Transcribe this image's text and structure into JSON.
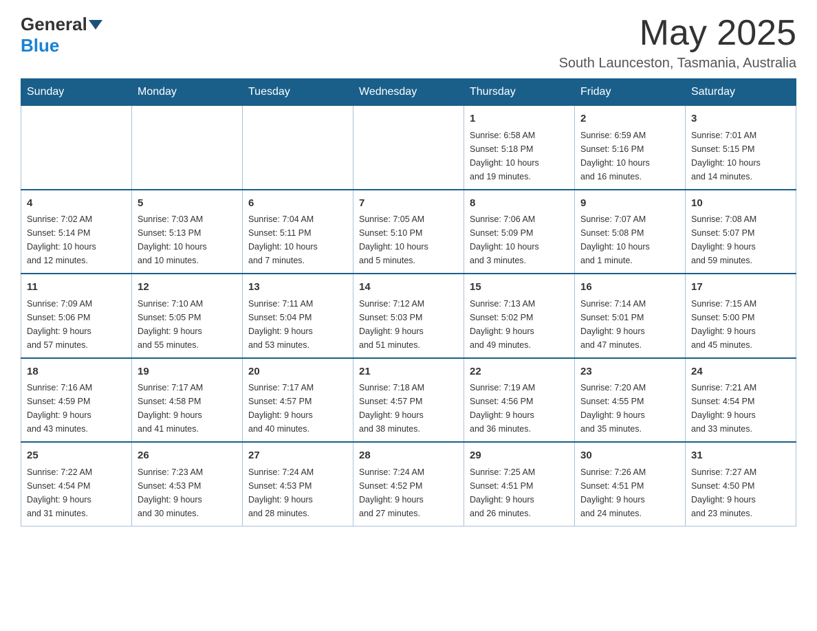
{
  "header": {
    "logo_general": "General",
    "logo_blue": "Blue",
    "month_title": "May 2025",
    "location": "South Launceston, Tasmania, Australia"
  },
  "days_of_week": [
    "Sunday",
    "Monday",
    "Tuesday",
    "Wednesday",
    "Thursday",
    "Friday",
    "Saturday"
  ],
  "weeks": [
    [
      {
        "day": "",
        "info": ""
      },
      {
        "day": "",
        "info": ""
      },
      {
        "day": "",
        "info": ""
      },
      {
        "day": "",
        "info": ""
      },
      {
        "day": "1",
        "info": "Sunrise: 6:58 AM\nSunset: 5:18 PM\nDaylight: 10 hours\nand 19 minutes."
      },
      {
        "day": "2",
        "info": "Sunrise: 6:59 AM\nSunset: 5:16 PM\nDaylight: 10 hours\nand 16 minutes."
      },
      {
        "day": "3",
        "info": "Sunrise: 7:01 AM\nSunset: 5:15 PM\nDaylight: 10 hours\nand 14 minutes."
      }
    ],
    [
      {
        "day": "4",
        "info": "Sunrise: 7:02 AM\nSunset: 5:14 PM\nDaylight: 10 hours\nand 12 minutes."
      },
      {
        "day": "5",
        "info": "Sunrise: 7:03 AM\nSunset: 5:13 PM\nDaylight: 10 hours\nand 10 minutes."
      },
      {
        "day": "6",
        "info": "Sunrise: 7:04 AM\nSunset: 5:11 PM\nDaylight: 10 hours\nand 7 minutes."
      },
      {
        "day": "7",
        "info": "Sunrise: 7:05 AM\nSunset: 5:10 PM\nDaylight: 10 hours\nand 5 minutes."
      },
      {
        "day": "8",
        "info": "Sunrise: 7:06 AM\nSunset: 5:09 PM\nDaylight: 10 hours\nand 3 minutes."
      },
      {
        "day": "9",
        "info": "Sunrise: 7:07 AM\nSunset: 5:08 PM\nDaylight: 10 hours\nand 1 minute."
      },
      {
        "day": "10",
        "info": "Sunrise: 7:08 AM\nSunset: 5:07 PM\nDaylight: 9 hours\nand 59 minutes."
      }
    ],
    [
      {
        "day": "11",
        "info": "Sunrise: 7:09 AM\nSunset: 5:06 PM\nDaylight: 9 hours\nand 57 minutes."
      },
      {
        "day": "12",
        "info": "Sunrise: 7:10 AM\nSunset: 5:05 PM\nDaylight: 9 hours\nand 55 minutes."
      },
      {
        "day": "13",
        "info": "Sunrise: 7:11 AM\nSunset: 5:04 PM\nDaylight: 9 hours\nand 53 minutes."
      },
      {
        "day": "14",
        "info": "Sunrise: 7:12 AM\nSunset: 5:03 PM\nDaylight: 9 hours\nand 51 minutes."
      },
      {
        "day": "15",
        "info": "Sunrise: 7:13 AM\nSunset: 5:02 PM\nDaylight: 9 hours\nand 49 minutes."
      },
      {
        "day": "16",
        "info": "Sunrise: 7:14 AM\nSunset: 5:01 PM\nDaylight: 9 hours\nand 47 minutes."
      },
      {
        "day": "17",
        "info": "Sunrise: 7:15 AM\nSunset: 5:00 PM\nDaylight: 9 hours\nand 45 minutes."
      }
    ],
    [
      {
        "day": "18",
        "info": "Sunrise: 7:16 AM\nSunset: 4:59 PM\nDaylight: 9 hours\nand 43 minutes."
      },
      {
        "day": "19",
        "info": "Sunrise: 7:17 AM\nSunset: 4:58 PM\nDaylight: 9 hours\nand 41 minutes."
      },
      {
        "day": "20",
        "info": "Sunrise: 7:17 AM\nSunset: 4:57 PM\nDaylight: 9 hours\nand 40 minutes."
      },
      {
        "day": "21",
        "info": "Sunrise: 7:18 AM\nSunset: 4:57 PM\nDaylight: 9 hours\nand 38 minutes."
      },
      {
        "day": "22",
        "info": "Sunrise: 7:19 AM\nSunset: 4:56 PM\nDaylight: 9 hours\nand 36 minutes."
      },
      {
        "day": "23",
        "info": "Sunrise: 7:20 AM\nSunset: 4:55 PM\nDaylight: 9 hours\nand 35 minutes."
      },
      {
        "day": "24",
        "info": "Sunrise: 7:21 AM\nSunset: 4:54 PM\nDaylight: 9 hours\nand 33 minutes."
      }
    ],
    [
      {
        "day": "25",
        "info": "Sunrise: 7:22 AM\nSunset: 4:54 PM\nDaylight: 9 hours\nand 31 minutes."
      },
      {
        "day": "26",
        "info": "Sunrise: 7:23 AM\nSunset: 4:53 PM\nDaylight: 9 hours\nand 30 minutes."
      },
      {
        "day": "27",
        "info": "Sunrise: 7:24 AM\nSunset: 4:53 PM\nDaylight: 9 hours\nand 28 minutes."
      },
      {
        "day": "28",
        "info": "Sunrise: 7:24 AM\nSunset: 4:52 PM\nDaylight: 9 hours\nand 27 minutes."
      },
      {
        "day": "29",
        "info": "Sunrise: 7:25 AM\nSunset: 4:51 PM\nDaylight: 9 hours\nand 26 minutes."
      },
      {
        "day": "30",
        "info": "Sunrise: 7:26 AM\nSunset: 4:51 PM\nDaylight: 9 hours\nand 24 minutes."
      },
      {
        "day": "31",
        "info": "Sunrise: 7:27 AM\nSunset: 4:50 PM\nDaylight: 9 hours\nand 23 minutes."
      }
    ]
  ]
}
